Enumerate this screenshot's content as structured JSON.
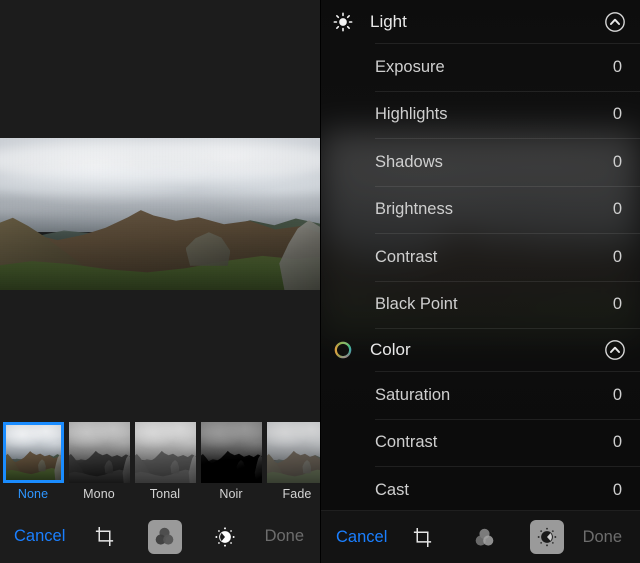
{
  "left_panel": {
    "photo": {
      "alt": "panoramic mountain ridge landscape under overcast sky"
    },
    "filters": {
      "items": [
        {
          "label": "None",
          "selected": true,
          "style": "f-none"
        },
        {
          "label": "Mono",
          "selected": false,
          "style": "f-mono"
        },
        {
          "label": "Tonal",
          "selected": false,
          "style": "f-tonal"
        },
        {
          "label": "Noir",
          "selected": false,
          "style": "f-noir"
        },
        {
          "label": "Fade",
          "selected": false,
          "style": "f-fade"
        }
      ]
    },
    "toolbar": {
      "cancel_label": "Cancel",
      "done_label": "Done",
      "tools": [
        {
          "icon": "crop-icon",
          "name": "crop-tool",
          "active": false
        },
        {
          "icon": "filters-icon",
          "name": "filters-tool",
          "active": true
        },
        {
          "icon": "adjust-icon",
          "name": "adjust-tool",
          "active": false
        }
      ]
    }
  },
  "right_panel": {
    "sections": [
      {
        "title": "Light",
        "icon": "sun-icon",
        "chevron": "chevron-up-circle-icon",
        "expanded": true,
        "adjustments": [
          {
            "name": "Exposure",
            "value": "0"
          },
          {
            "name": "Highlights",
            "value": "0"
          },
          {
            "name": "Shadows",
            "value": "0"
          },
          {
            "name": "Brightness",
            "value": "0"
          },
          {
            "name": "Contrast",
            "value": "0"
          },
          {
            "name": "Black Point",
            "value": "0"
          }
        ]
      },
      {
        "title": "Color",
        "icon": "color-wheel-icon",
        "chevron": "chevron-up-circle-icon",
        "expanded": true,
        "adjustments": [
          {
            "name": "Saturation",
            "value": "0"
          },
          {
            "name": "Contrast",
            "value": "0"
          },
          {
            "name": "Cast",
            "value": "0"
          }
        ]
      }
    ],
    "toolbar": {
      "cancel_label": "Cancel",
      "done_label": "Done",
      "tools": [
        {
          "icon": "crop-icon",
          "name": "crop-tool",
          "active": false
        },
        {
          "icon": "filters-icon",
          "name": "filters-tool",
          "active": false
        },
        {
          "icon": "adjust-icon",
          "name": "adjust-tool",
          "active": true
        }
      ]
    }
  },
  "colors": {
    "accent_blue": "#1a7fff",
    "selection_blue": "#1a8cff",
    "disabled_gray": "#6d6d6d",
    "panel_bg": "#1c1c1c",
    "right_panel_bg": "#0d0d0d",
    "row_text": "#cfcfcf"
  }
}
